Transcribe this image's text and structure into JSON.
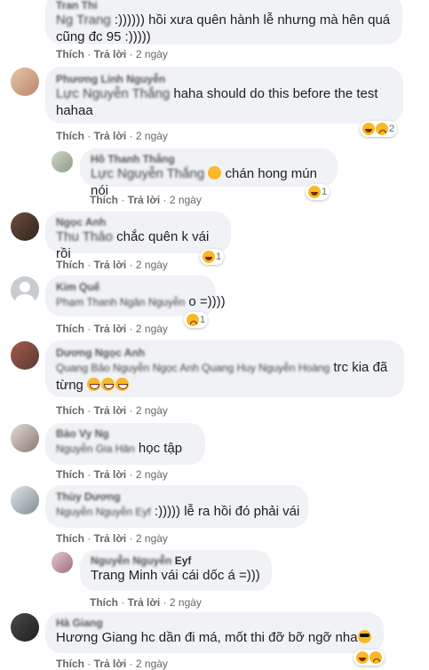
{
  "actions": {
    "like": "Thích",
    "reply": "Trả lời",
    "time": "2 ngày"
  },
  "comments": [
    {
      "author": "Tran Thi",
      "prefix": "Ng Trang",
      "text": ":)))))) hồi xưa quên hành lễ nhưng mà hên quá",
      "text2": "cũng đc 95 :)))))"
    },
    {
      "author": "Phương Linh Nguyễn",
      "prefix": "Lực Nguyễn Thắng",
      "text": "haha should do this before the test",
      "text2": "hahaa",
      "react_count": "2"
    },
    {
      "author": "Hồ Thanh Thắng",
      "prefix": "Lực Nguyễn Thắng",
      "text": "chán hong mún nói",
      "react_count": "1"
    },
    {
      "author": "Ngọc Anh",
      "prefix": "Thu Thảo",
      "text": "chắc quên k vái rồi",
      "react_count": "1"
    },
    {
      "author": "Kim Quế",
      "prefix": "Phạm Thanh Ngân Nguyễn",
      "suffix": "o =))))",
      "react_count": "1"
    },
    {
      "author": "Dương Ngọc Anh",
      "prefix": "Quang Bảo Nguyễn Ngọc Anh Quang Huy Nguyễn Hoàng",
      "text": "trc kia đã",
      "text2": "từng"
    },
    {
      "author": "Bảo Vy Ng",
      "prefix": "Nguyễn Gia Hân",
      "text": "học tập"
    },
    {
      "author": "Thùy Dương",
      "prefix": "Nguyễn Nguyễn Eyf",
      "text": ":))))) lễ ra hồi đó phải vái"
    },
    {
      "author": "Nguyễn Nguyễn",
      "suffix": "Eyf",
      "text": "Trang Minh vái cái dốc á =)))"
    },
    {
      "author": "Hà Giang",
      "text": "Hương Giang hc dần đi má, mốt thi đỡ bỡ ngỡ nha"
    }
  ]
}
